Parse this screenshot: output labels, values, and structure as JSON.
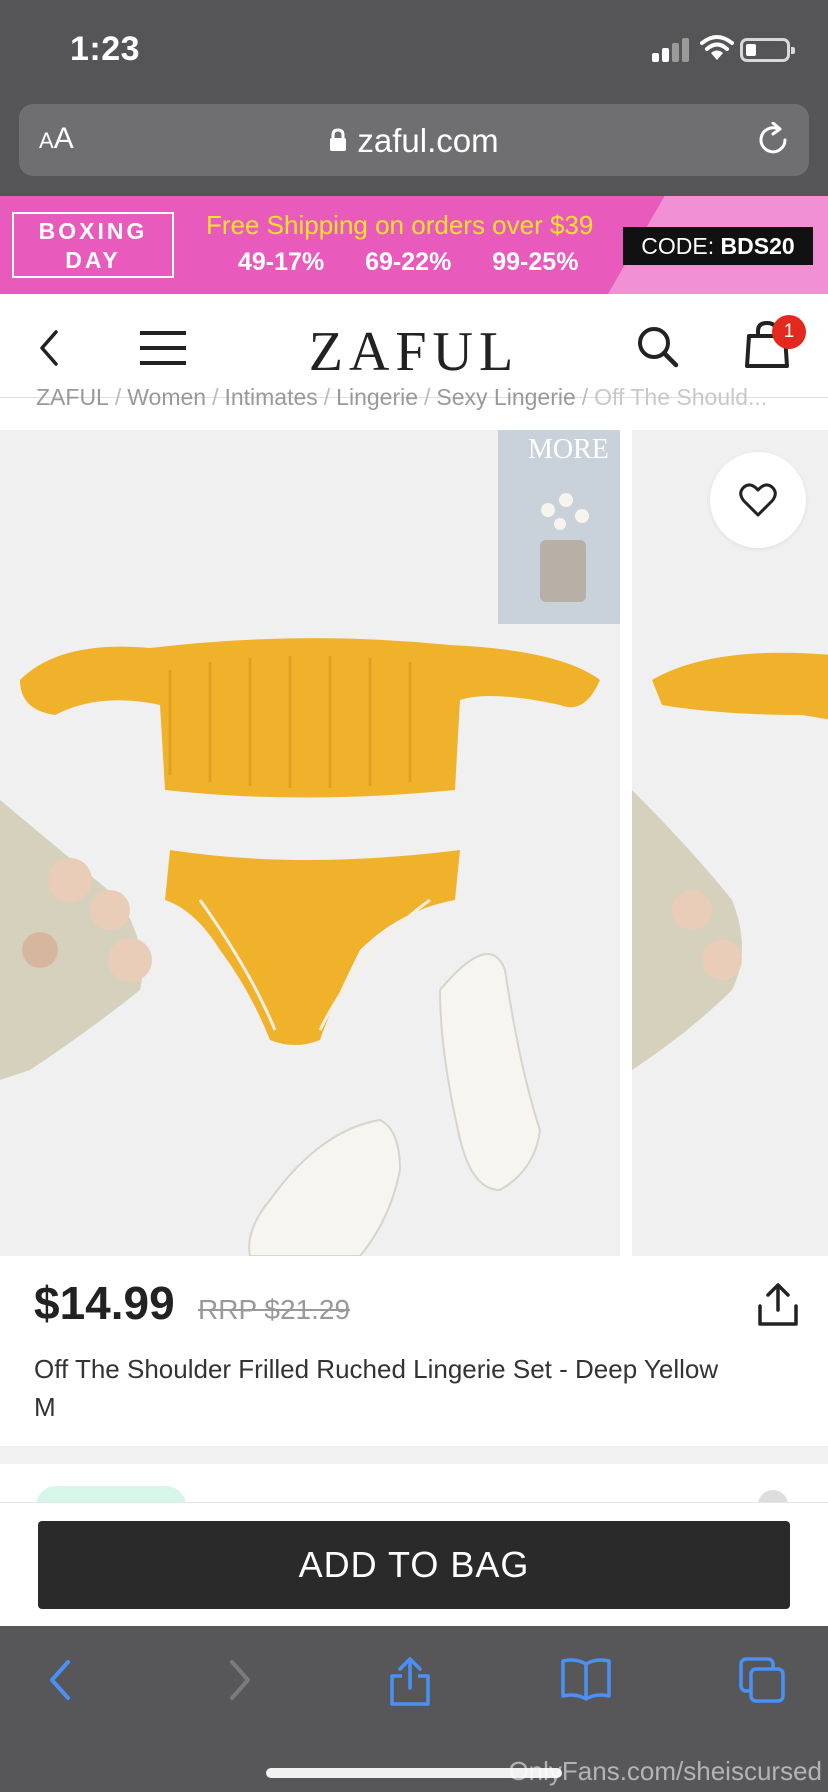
{
  "status_bar": {
    "time": "1:23"
  },
  "browser": {
    "text_size_label": "AA",
    "url": "zaful.com"
  },
  "promo": {
    "boxing_day_line1": "BOXING",
    "boxing_day_line2": "DAY",
    "free_shipping": "Free Shipping on orders over $39",
    "tiers": [
      "49-17%",
      "69-22%",
      "99-25%"
    ],
    "code_label": "CODE:",
    "code_value": "BDS20",
    "colors": {
      "background": "#e85bbd",
      "headline": "#ffe12a"
    }
  },
  "header": {
    "logo": "ZAFUL",
    "cart_count": "1"
  },
  "breadcrumb": {
    "items": [
      "ZAFUL",
      "Women",
      "Intimates",
      "Lingerie",
      "Sexy Lingerie"
    ],
    "current": "Off The Should..."
  },
  "gallery": {
    "magazine_text": "MORE"
  },
  "product": {
    "price": "$14.99",
    "rrp": "RRP $21.29",
    "title": "Off The Shoulder Frilled Ruched Lingerie Set - Deep Yellow M"
  },
  "actions": {
    "add_to_bag": "ADD TO BAG"
  },
  "watermark": "OnlyFans.com/sheiscursed",
  "icons": [
    "back-icon",
    "menu-icon",
    "search-icon",
    "bag-icon",
    "heart-icon",
    "share-icon",
    "lock-icon",
    "reload-icon"
  ]
}
